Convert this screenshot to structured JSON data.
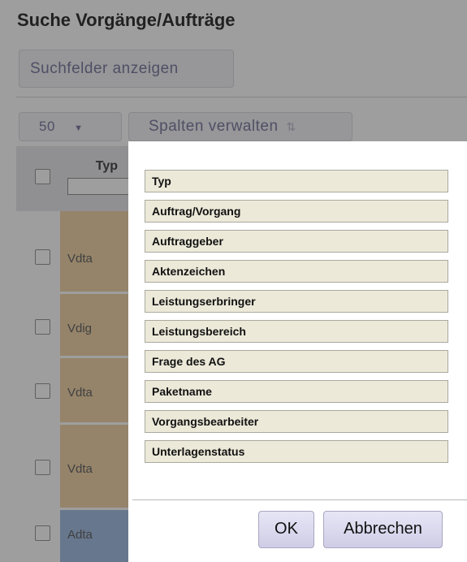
{
  "page": {
    "title": "Suche Vorgänge/Aufträge",
    "show_fields_label": "Suchfelder anzeigen",
    "page_size": "50",
    "page_size_arrow": "▼",
    "manage_columns_label": "Spalten verwalten",
    "manage_columns_icon": "⇅"
  },
  "table": {
    "header_typ": "Typ",
    "rows": [
      {
        "typ": "Vdta",
        "color": "#efd0a0"
      },
      {
        "typ": "Vdig",
        "color": "#efd0a0"
      },
      {
        "typ": "Vdta",
        "color": "#efd0a0"
      },
      {
        "typ": "Vdta",
        "color": "#efd0a0"
      },
      {
        "typ": "Adta",
        "color": "#9bb9e0"
      }
    ]
  },
  "dialog": {
    "columns": [
      "Typ",
      "Auftrag/Vorgang",
      "Auftraggeber",
      "Aktenzeichen",
      "Leistungserbringer",
      "Leistungsbereich",
      "Frage des AG",
      "Paketname",
      "Vorgangsbearbeiter",
      "Unterlagenstatus"
    ],
    "ok_label": "OK",
    "cancel_label": "Abbrechen"
  }
}
